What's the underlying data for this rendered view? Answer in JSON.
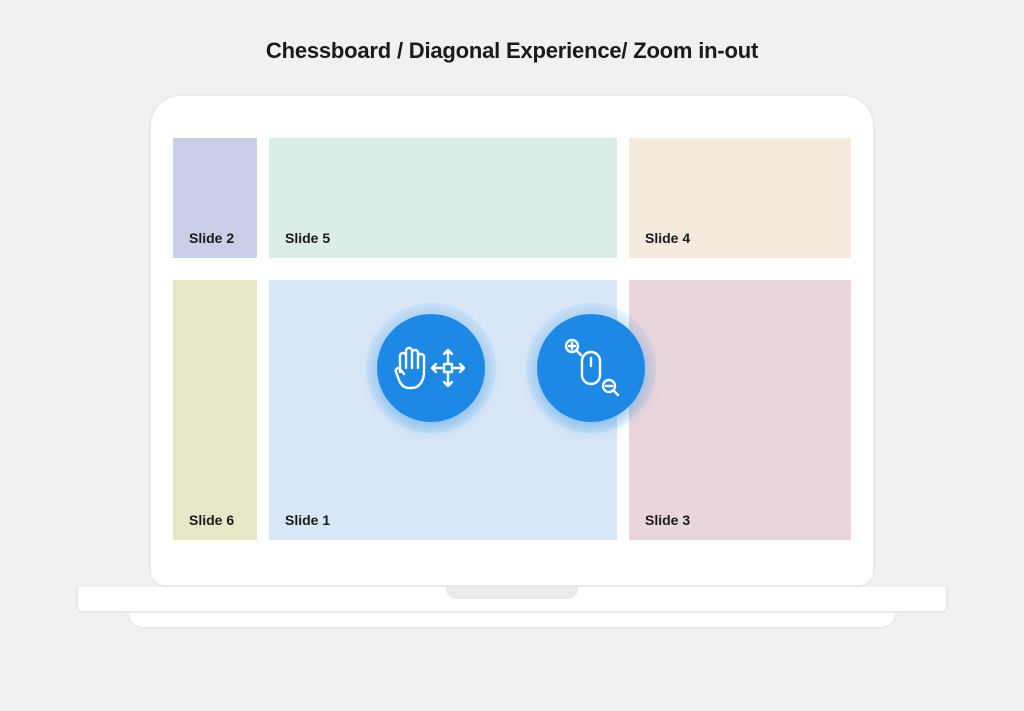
{
  "title": "Chessboard / Diagonal Experience/  Zoom in-out",
  "slides": {
    "top": [
      {
        "label": "Slide 2",
        "color": "c-lav",
        "width": "w-narrow"
      },
      {
        "label": "Slide 5",
        "color": "c-mint",
        "width": "w-wide"
      },
      {
        "label": "Slide 4",
        "color": "c-peach",
        "width": "w-right"
      }
    ],
    "bottom": [
      {
        "label": "Slide 6",
        "color": "c-olive",
        "width": "w-narrow"
      },
      {
        "label": "Slide 1",
        "color": "c-blue",
        "width": "w-wide"
      },
      {
        "label": "Slide 3",
        "color": "c-rose",
        "width": "w-right"
      }
    ]
  },
  "actions": {
    "pan": {
      "name": "pan-move"
    },
    "zoom": {
      "name": "zoom-in-out"
    }
  },
  "colors": {
    "accent": "#1e88e5",
    "icon_stroke": "#ffffff"
  }
}
